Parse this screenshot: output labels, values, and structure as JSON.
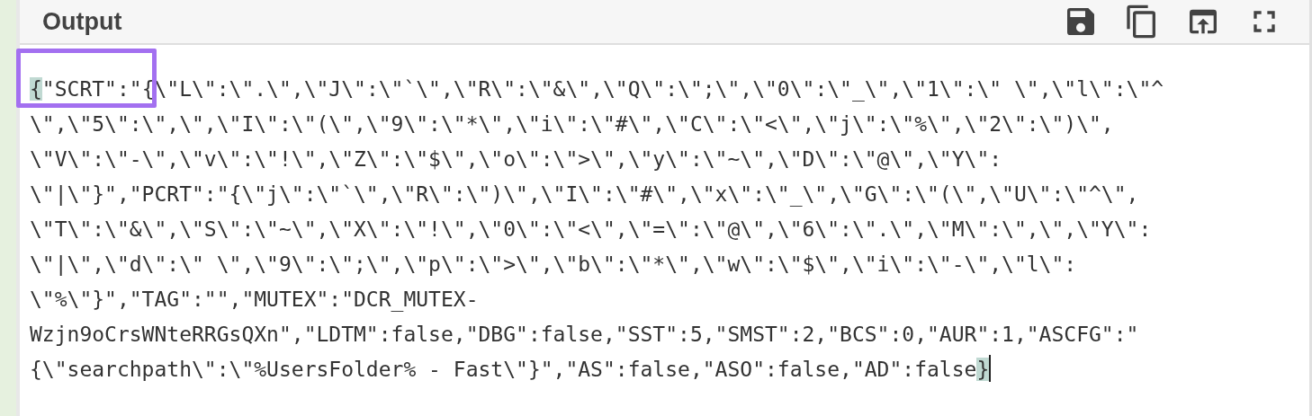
{
  "panel": {
    "title": "Output"
  },
  "output": {
    "bracket_match": true,
    "cursor_at_end": true,
    "lines": [
      "{\"SCRT\":\"{\\\"L\\\":\\\".\\\",\\\"J\\\":\\\"`\\\",\\\"R\\\":\\\"&\\\",\\\"Q\\\":\\\";\\\",\\\"0\\\":\\\"_\\\",\\\"1\\\":\\\" \\\",\\\"l\\\":\\\"^",
      "\\\",\\\"5\\\":\\\",\\\",\\\"I\\\":\\\"(\\\",\\\"9\\\":\\\"*\\\",\\\"i\\\":\\\"#\\\",\\\"C\\\":\\\"<\\\",\\\"j\\\":\\\"%\\\",\\\"2\\\":\\\")\\\",",
      "\\\"V\\\":\\\"-\\\",\\\"v\\\":\\\"!\\\",\\\"Z\\\":\\\"$\\\",\\\"o\\\":\\\">\\\",\\\"y\\\":\\\"~\\\",\\\"D\\\":\\\"@\\\",\\\"Y\\\":",
      "\\\"|\\\"}\",\"PCRT\":\"{\\\"j\\\":\\\"`\\\",\\\"R\\\":\\\")\\\",\\\"I\\\":\\\"#\\\",\\\"x\\\":\\\"_\\\",\\\"G\\\":\\\"(\\\",\\\"U\\\":\\\"^\\\",",
      "\\\"T\\\":\\\"&\\\",\\\"S\\\":\\\"~\\\",\\\"X\\\":\\\"!\\\",\\\"0\\\":\\\"<\\\",\\\"=\\\":\\\"@\\\",\\\"6\\\":\\\".\\\",\\\"M\\\":\\\",\\\",\\\"Y\\\":",
      "\\\"|\\\",\\\"d\\\":\\\" \\\",\\\"9\\\":\\\";\\\",\\\"p\\\":\\\">\\\",\\\"b\\\":\\\"*\\\",\\\"w\\\":\\\"$\\\",\\\"i\\\":\\\"-\\\",\\\"l\\\":",
      "\\\"%\\\"}\",\"TAG\":\"\",\"MUTEX\":\"DCR_MUTEX-",
      "Wzjn9oCrsWNteRRGsQXn\",\"LDTM\":false,\"DBG\":false,\"SST\":5,\"SMST\":2,\"BCS\":0,\"AUR\":1,\"ASCFG\":\"",
      "{\\\"searchpath\\\":\\\"%UsersFolder% - Fast\\\"}\",\"AS\":false,\"ASO\":false,\"AD\":false}"
    ]
  }
}
